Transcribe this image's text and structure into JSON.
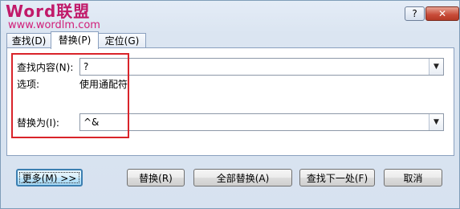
{
  "watermark": {
    "logo_text": "Word联盟",
    "url": "www.wordlm.com"
  },
  "title_buttons": {
    "help": "?",
    "close": "✕"
  },
  "tabs": [
    {
      "label": "查找(D)",
      "active": false
    },
    {
      "label": "替换(P)",
      "active": true
    },
    {
      "label": "定位(G)",
      "active": false
    }
  ],
  "find": {
    "label": "查找内容(N):",
    "value": "?",
    "options_label": "选项:",
    "options_value": "使用通配符"
  },
  "replace": {
    "label": "替换为(I):",
    "value": "^&"
  },
  "buttons": {
    "more": "更多(M) >>",
    "replace": "替换(R)",
    "replace_all": "全部替换(A)",
    "find_next": "查找下一处(F)",
    "cancel": "取消"
  },
  "icons": {
    "dropdown": "chevron-down-icon"
  },
  "colors": {
    "highlight": "#d9242a",
    "watermark": "#c11a6a",
    "focus": "#3c7fb1"
  }
}
